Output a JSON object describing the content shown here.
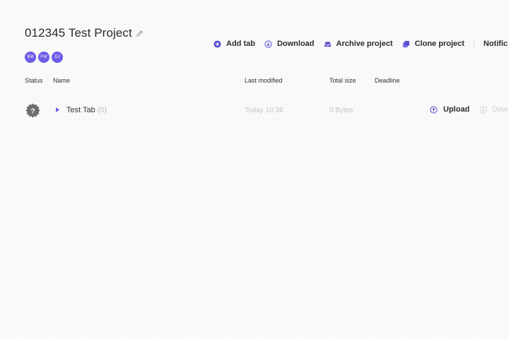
{
  "project": {
    "title": "012345 Test Project"
  },
  "members": [
    {
      "initials": "BM"
    },
    {
      "initials": "FW"
    },
    {
      "initials": "DJ"
    }
  ],
  "toolbar": {
    "add_tab": "Add tab",
    "download": "Download",
    "archive": "Archive project",
    "clone": "Clone project",
    "notifications": "Notific"
  },
  "table": {
    "headers": {
      "status": "Status",
      "name": "Name",
      "last_modified": "Last modified",
      "total_size": "Total size",
      "deadline": "Deadline"
    },
    "rows": [
      {
        "status_symbol": "?",
        "name": "Test Tab",
        "count": "(0)",
        "last_modified": "Today 10:38",
        "total_size": "0 Bytes",
        "upload_label": "Upload",
        "download_label": "Dow"
      }
    ]
  },
  "colors": {
    "accent": "#6c5ce7",
    "text": "#2b2b2b",
    "muted": "#c4c4c4"
  }
}
